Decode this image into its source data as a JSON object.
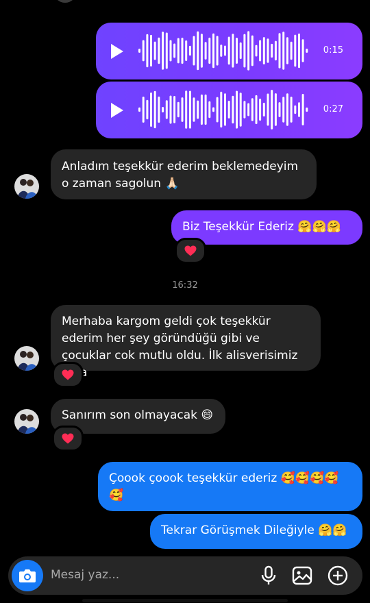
{
  "voice_messages": [
    {
      "duration": "0:15"
    },
    {
      "duration": "0:27"
    }
  ],
  "messages": {
    "m1": {
      "text": "Anladım teşekkür ederim beklemedeyim o zaman sagolun 🙏🏻"
    },
    "m2": {
      "text": "Biz Teşekkür Ederiz 🤗🤗🤗",
      "reaction": "heart"
    },
    "m3": {
      "text": "Merhaba kargom geldi çok teşekkür ederim her şey göründüğü gibi ve çocuklar cok mutlu oldu. İlk alisverisimiz ama",
      "reaction": "heart"
    },
    "m4": {
      "text": "Sanırım son olmayacak 😄",
      "reaction": "heart"
    },
    "m5": {
      "text": "Çoook çoook teşekkür ederiz 🥰🥰🥰🥰🥰"
    },
    "m6": {
      "text": "Tekrar Görüşmek Dileğiyle 🤗🤗"
    }
  },
  "timestamp": "16:32",
  "composer": {
    "placeholder": "Mesaj yaz...",
    "icons": [
      "camera-icon",
      "microphone-icon",
      "gallery-icon",
      "plus-icon"
    ]
  },
  "colors": {
    "background": "#000000",
    "received_bubble": "#262626",
    "sent_purple": "#7c3aff",
    "sent_blue": "#1679f6",
    "heart": "#ff2d55"
  }
}
